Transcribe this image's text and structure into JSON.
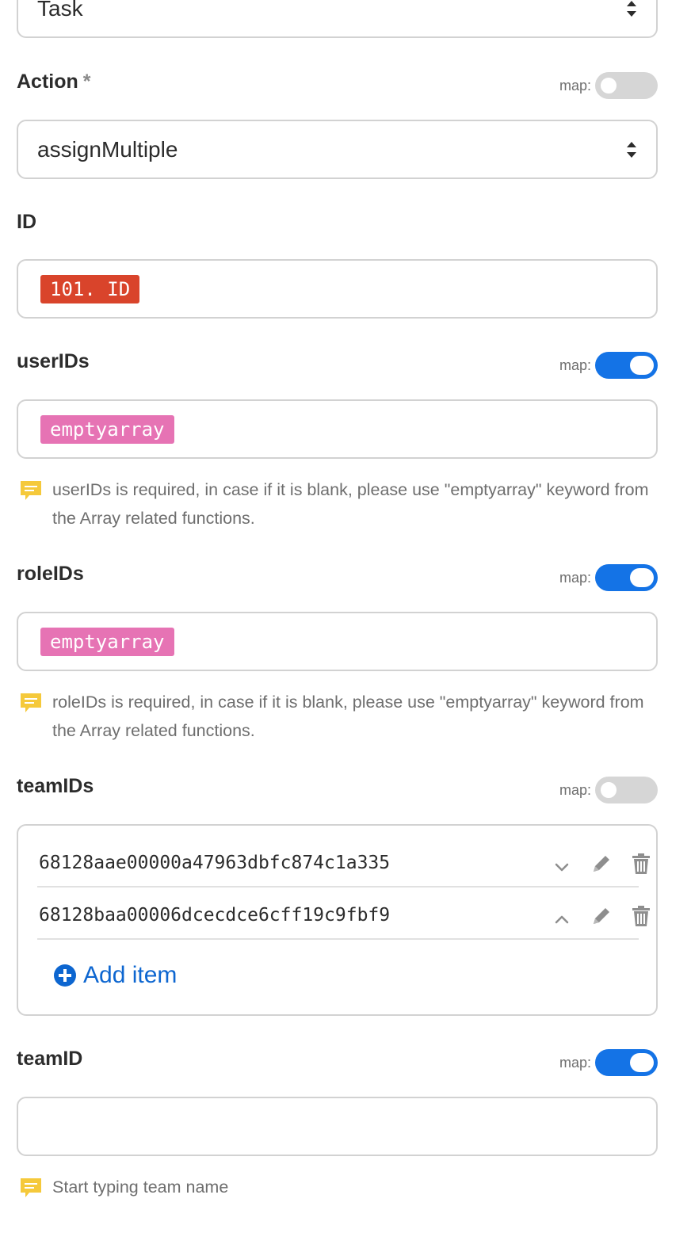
{
  "module": {
    "value": "Task"
  },
  "action": {
    "label": "Action",
    "required_mark": "*",
    "map_label": "map:",
    "map_enabled": false,
    "value": "assignMultiple"
  },
  "id_field": {
    "label": "ID",
    "token": "101. ID",
    "token_color": "#d9442b"
  },
  "userIDs": {
    "label": "userIDs",
    "map_label": "map:",
    "map_enabled": true,
    "token": "emptyarray",
    "token_color": "#e673b4",
    "hint": "userIDs is required, in case if it is blank, please use \"emptyarray\" keyword from the Array related functions."
  },
  "roleIDs": {
    "label": "roleIDs",
    "map_label": "map:",
    "map_enabled": true,
    "token": "emptyarray",
    "token_color": "#e673b4",
    "hint": "roleIDs is required, in case if it is blank, please use \"emptyarray\" keyword from the Array related functions."
  },
  "teamIDs": {
    "label": "teamIDs",
    "map_label": "map:",
    "map_enabled": false,
    "items": [
      {
        "value": "68128aae00000a47963dbfc874c1a335",
        "move_icon": "chevron-down-icon"
      },
      {
        "value": "68128baa00006dcecdce6cff19c9fbf9",
        "move_icon": "chevron-up-icon"
      }
    ],
    "add_item_label": "Add item"
  },
  "teamID": {
    "label": "teamID",
    "map_label": "map:",
    "map_enabled": true,
    "value": "",
    "hint": "Start typing team name"
  },
  "colors": {
    "accent": "#1473e6",
    "link": "#0d66d0",
    "hint_icon": "#f5c93b",
    "border": "#d2d2d2"
  }
}
